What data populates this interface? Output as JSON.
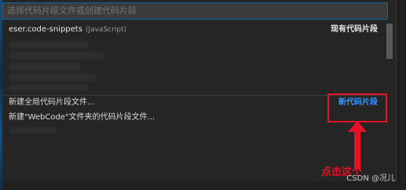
{
  "quick_pick": {
    "search_placeholder": "选择代码片段文件或创建代码片段"
  },
  "rows": {
    "existing": {
      "label": "eser.code-snippets",
      "description": "(JavaScript)",
      "group_label": "现有代码片段"
    },
    "new_global": {
      "label": "新建全局代码片段文件...",
      "group_label": "新代码片段"
    },
    "new_folder": {
      "label": "新建\"WebCode\"文件夹的代码片段文件..."
    }
  },
  "annotation": {
    "text": "点击这个",
    "color": "#e81123"
  },
  "watermark": "CSDN @况儿",
  "colors": {
    "accent_blue": "#3794ff",
    "input_border": "#0e639c",
    "panel_bg": "#252526"
  }
}
